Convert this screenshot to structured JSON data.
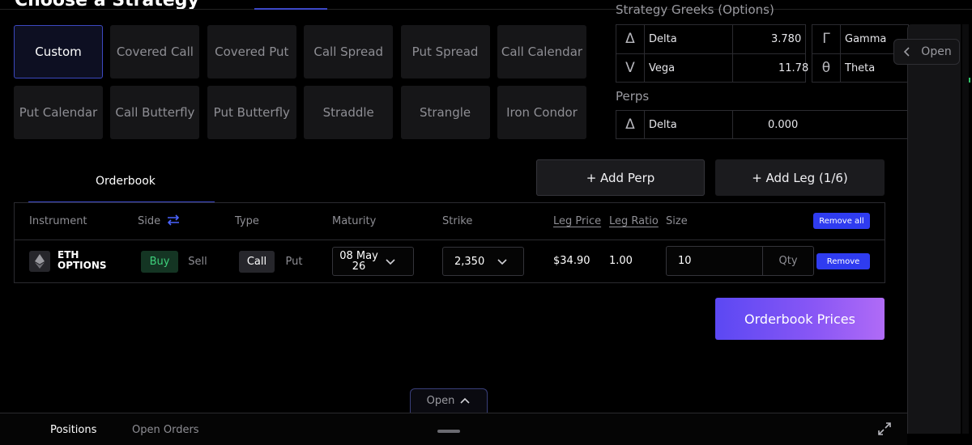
{
  "header": {
    "title": "Choose a Strategy"
  },
  "strategies": [
    {
      "label": "Custom",
      "active": true
    },
    {
      "label": "Covered Call"
    },
    {
      "label": "Covered Put"
    },
    {
      "label": "Call Spread"
    },
    {
      "label": "Put Spread"
    },
    {
      "label": "Call Calendar"
    },
    {
      "label": "Put Calendar"
    },
    {
      "label": "Call Butterfly"
    },
    {
      "label": "Put Butterfly"
    },
    {
      "label": "Straddle"
    },
    {
      "label": "Strangle"
    },
    {
      "label": "Iron Condor"
    }
  ],
  "greeks": {
    "title": "Strategy Greeks (Options)",
    "delta": {
      "symbol": "Δ",
      "label": "Delta",
      "value": "3.780"
    },
    "vega": {
      "symbol": "V",
      "label": "Vega",
      "value": "11.78"
    },
    "gamma": {
      "symbol": "Γ",
      "label": "Gamma"
    },
    "theta": {
      "symbol": "θ",
      "label": "Theta"
    }
  },
  "perps": {
    "title": "Perps",
    "delta": {
      "symbol": "Δ",
      "label": "Delta",
      "value": "0.000"
    }
  },
  "side_panel": {
    "open_label": "Open"
  },
  "orderbook": {
    "tab_label": "Orderbook",
    "add_perp_label": "+ Add Perp",
    "add_leg_label": "+ Add Leg (1/6)",
    "prices_button_label": "Orderbook Prices"
  },
  "leg_table": {
    "headers": {
      "instrument": "Instrument",
      "side": "Side",
      "type": "Type",
      "maturity": "Maturity",
      "strike": "Strike",
      "leg_price": "Leg Price",
      "leg_ratio": "Leg Ratio",
      "size": "Size"
    },
    "remove_all_label": "Remove all",
    "row": {
      "instrument_line1": "ETH",
      "instrument_line2": "OPTIONS",
      "side_buy": "Buy",
      "side_sell": "Sell",
      "type_call": "Call",
      "type_put": "Put",
      "maturity_line1": "08 May",
      "maturity_line2": "26",
      "strike": "2,350",
      "leg_price": "$34.90",
      "leg_ratio": "1.00",
      "size": "10",
      "qty_placeholder": "Qty",
      "remove_label": "Remove"
    }
  },
  "bottom": {
    "open_label": "Open",
    "positions_label": "Positions",
    "open_orders_label": "Open Orders"
  },
  "colors": {
    "accent": "#2f3cf0",
    "buy_green": "#3ed07b",
    "gradient_start": "#5b48f3",
    "gradient_end": "#b06bf6"
  }
}
